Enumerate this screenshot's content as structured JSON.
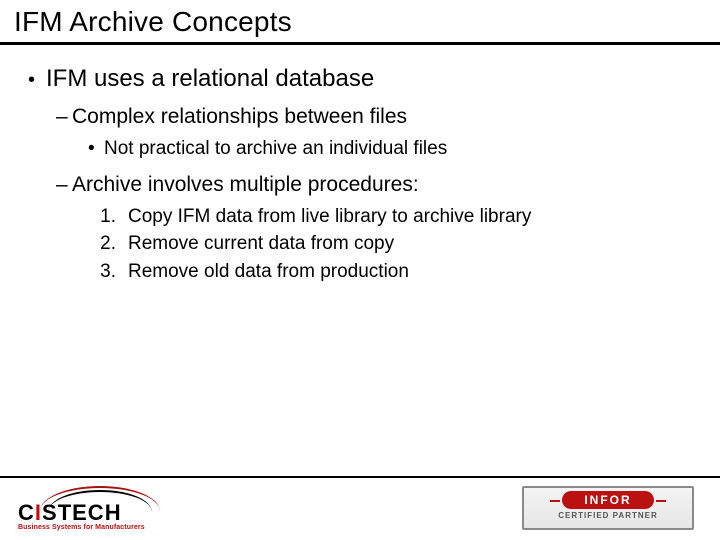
{
  "title": "IFM Archive Concepts",
  "content": {
    "lvl1": "IFM uses a relational database",
    "lvl2a": "Complex relationships between files",
    "lvl3a": "Not practical to archive an individual files",
    "lvl2b": "Archive involves multiple procedures:",
    "steps": [
      "Copy IFM data from live library to archive library",
      "Remove current data from copy",
      "Remove old data from production"
    ]
  },
  "logos": {
    "left_word_pre": "C",
    "left_word_i": "I",
    "left_word_post": "STECH",
    "left_tag": "Business Systems for Manufacturers",
    "right_word": "INFOR",
    "right_sub": "CERTIFIED PARTNER"
  }
}
